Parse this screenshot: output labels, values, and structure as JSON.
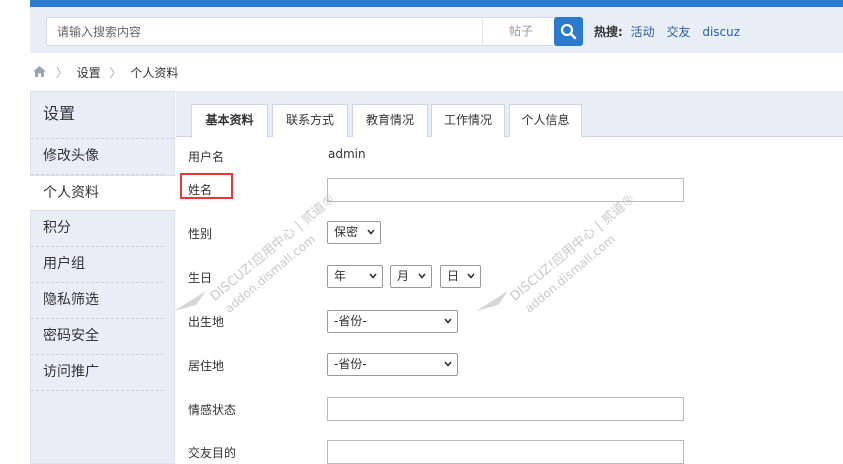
{
  "search": {
    "placeholder": "请输入搜索内容",
    "scope": "帖子",
    "hot_label": "热搜:",
    "hot_links": [
      "活动",
      "交友",
      "discuz"
    ]
  },
  "breadcrumb": [
    "设置",
    "个人资料"
  ],
  "sidebar": {
    "title": "设置",
    "items": [
      {
        "label": "修改头像"
      },
      {
        "label": "个人资料"
      },
      {
        "label": "积分"
      },
      {
        "label": "用户组"
      },
      {
        "label": "隐私筛选"
      },
      {
        "label": "密码安全"
      },
      {
        "label": "访问推广"
      }
    ],
    "active_index": 1
  },
  "tabs": [
    {
      "label": "基本资料"
    },
    {
      "label": "联系方式"
    },
    {
      "label": "教育情况"
    },
    {
      "label": "工作情况"
    },
    {
      "label": "个人信息"
    }
  ],
  "form": {
    "username_label": "用户名",
    "username_value": "admin",
    "name_label": "姓名",
    "name_value": "",
    "gender_label": "性别",
    "gender_value": "保密",
    "birthday_label": "生日",
    "birth_year": "年",
    "birth_month": "月",
    "birth_day": "日",
    "birthplace_label": "出生地",
    "birthplace_value": "-省份-",
    "residence_label": "居住地",
    "residence_value": "-省份-",
    "emotion_label": "情感状态",
    "emotion_value": "",
    "purpose_label": "交友目的",
    "purpose_value": ""
  },
  "watermark": {
    "line1": "DISCUZ!应用中心 | 贰道®",
    "line2": "addon.dismall.com"
  },
  "colors": {
    "accent": "#2b7acd",
    "panel_bg": "#e8eef7",
    "highlight": "#e53935",
    "link": "#2b5ea6"
  }
}
